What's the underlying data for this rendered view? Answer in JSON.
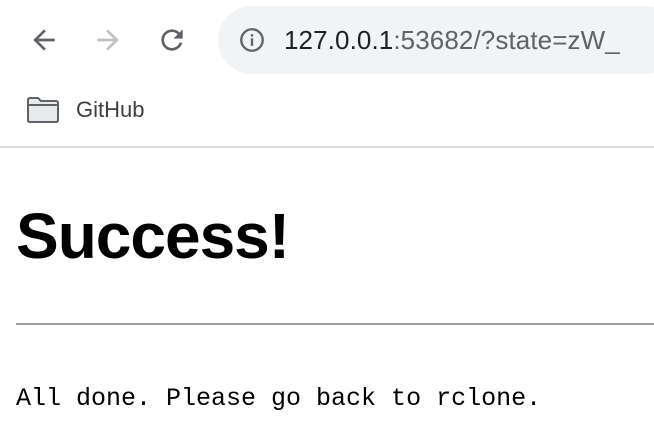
{
  "browser": {
    "nav": {
      "back_icon": "arrow-left-icon",
      "forward_icon": "arrow-right-icon",
      "reload_icon": "reload-icon"
    },
    "address_bar": {
      "security_icon": "info-icon",
      "url_host": "127.0.0.1",
      "url_rest": ":53682/?state=zW_"
    },
    "bookmarks": [
      {
        "label": "GitHub",
        "icon": "folder-icon"
      }
    ]
  },
  "page": {
    "title": "Success!",
    "message": "All done. Please go back to rclone."
  },
  "colors": {
    "omnibox_bg": "#f1f3f4",
    "icon_active": "#5f6368",
    "icon_disabled": "#bdc1c6",
    "divider": "#9e9e9e"
  }
}
